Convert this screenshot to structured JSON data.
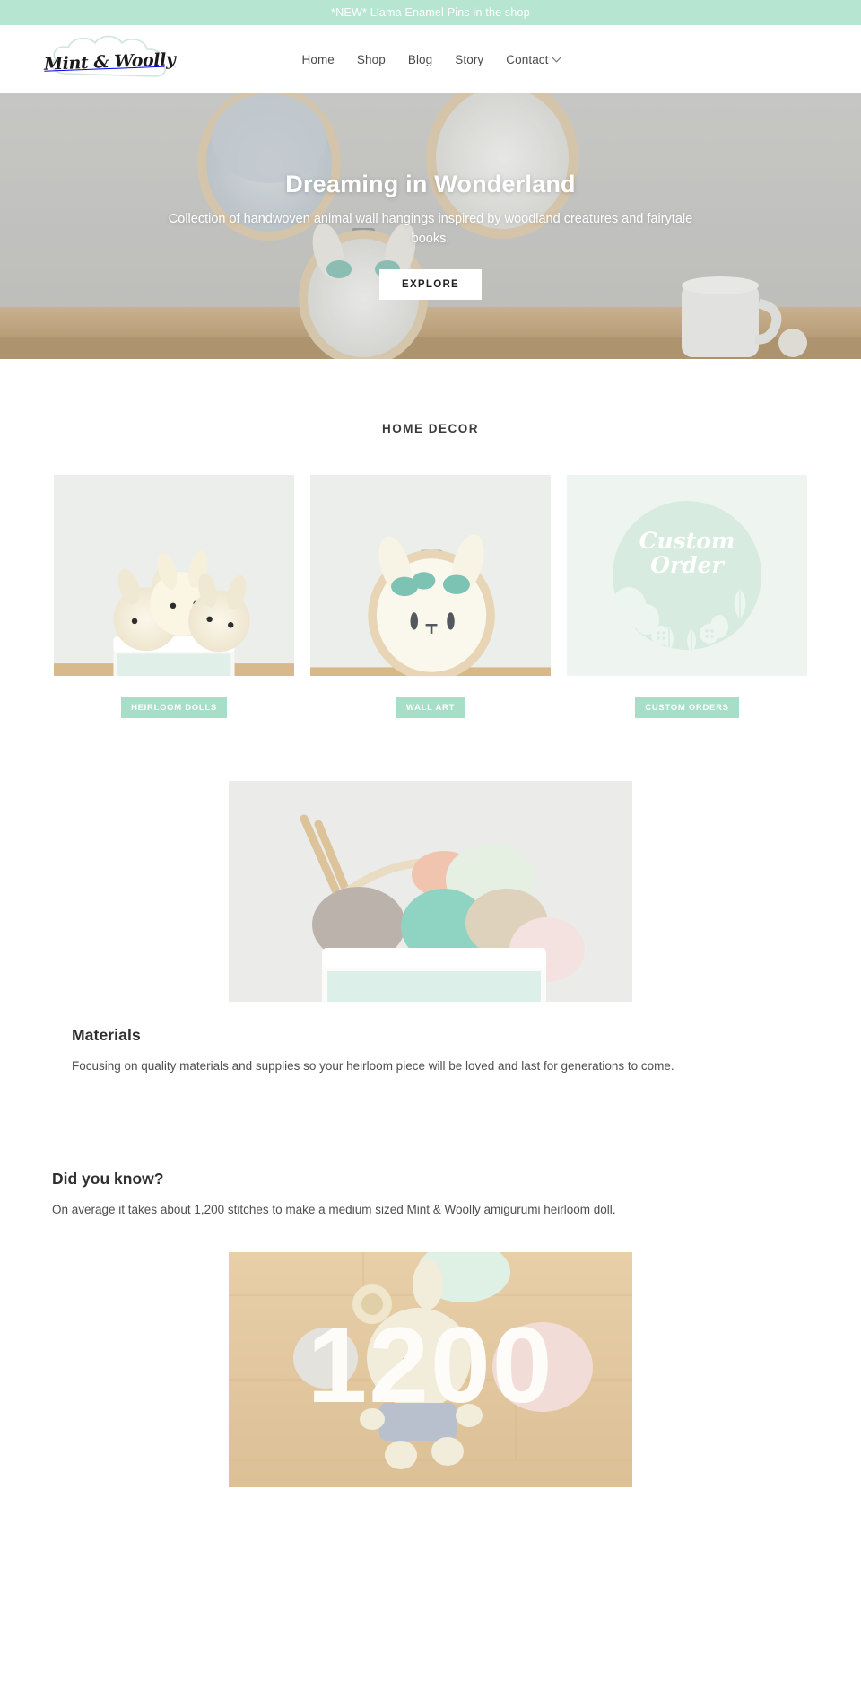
{
  "announcement": {
    "text": "*NEW* Llama Enamel Pins in the shop",
    "bg_color": "#b6e6d2"
  },
  "header": {
    "logo_text": "Mint & Woolly",
    "logo_shape": "cloud-outline",
    "nav": [
      {
        "label": "Home",
        "has_dropdown": false
      },
      {
        "label": "Shop",
        "has_dropdown": false
      },
      {
        "label": "Blog",
        "has_dropdown": false
      },
      {
        "label": "Story",
        "has_dropdown": false
      },
      {
        "label": "Contact",
        "has_dropdown": true
      }
    ]
  },
  "hero": {
    "title": "Dreaming in Wonderland",
    "subtitle": "Collection of handwoven animal wall hangings inspired by woodland creatures and fairytale books.",
    "button_label": "EXPLORE",
    "image_description": "woven bunny wall hangings in embroidery hoops on a grey wall above a wooden shelf with a white mug"
  },
  "collection": {
    "heading": "HOME DECOR",
    "label_color": "#a8ddc8",
    "cards": [
      {
        "label": "HEIRLOOM DOLLS",
        "image_description": "three cream amigurumi bunny dolls in a white wire basket"
      },
      {
        "label": "WALL ART",
        "image_description": "cream woven bunny face wall hanging in a wooden embroidery hoop with mint leaves"
      },
      {
        "label": "CUSTOM ORDERS",
        "graphic_text_line1": "Custom",
        "graphic_text_line2": "Order",
        "image_description": "mint green circle badge with script lettering and leaf and button decorations"
      }
    ]
  },
  "materials": {
    "title": "Materials",
    "body": "Focusing on quality materials and supplies so your heirloom piece will be loved and last for generations to come.",
    "image_description": "pastel yarn skeins and wooden knitting needles in a white wire basket"
  },
  "fact": {
    "title": "Did you know?",
    "body": "On average it takes about 1,200 stitches to make a medium sized Mint & Woolly amigurumi heirloom doll.",
    "number": "1200",
    "image_description": "cream amigurumi doll with pink and grey yarn balls on a light wooden floor"
  }
}
